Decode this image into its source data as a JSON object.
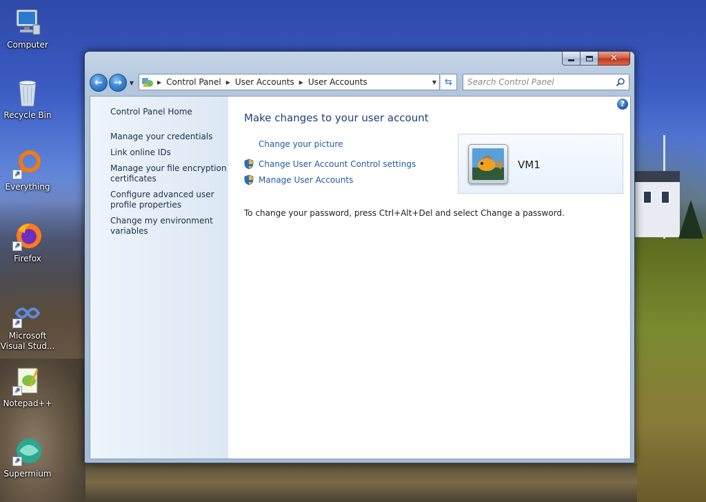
{
  "desktop": {
    "icons": [
      {
        "label": "Computer"
      },
      {
        "label": "Recycle Bin"
      },
      {
        "label": "Everything"
      },
      {
        "label": "Firefox"
      },
      {
        "label": "Microsoft Visual Stud..."
      },
      {
        "label": "Notepad++"
      },
      {
        "label": "Supermium"
      }
    ]
  },
  "window": {
    "controls": {
      "minimize": "minimize",
      "maximize": "maximize",
      "close": "✕"
    },
    "nav": {
      "back": "back",
      "forward": "forward",
      "refresh": "refresh"
    },
    "address": {
      "crumbs": [
        "Control Panel",
        "User Accounts",
        "User Accounts"
      ]
    },
    "search": {
      "placeholder": "Search Control Panel"
    },
    "help": "?",
    "left_pane": {
      "home": "Control Panel Home",
      "links": [
        "Manage your credentials",
        "Link online IDs",
        "Manage your file encryption certificates",
        "Configure advanced user profile properties",
        "Change my environment variables"
      ]
    },
    "main": {
      "title": "Make changes to your user account",
      "tasks": [
        {
          "label": "Change your picture",
          "icon": "none"
        },
        {
          "label": "Change User Account Control settings",
          "icon": "uac-shield-icon"
        },
        {
          "label": "Manage User Accounts",
          "icon": "uac-shield-icon"
        }
      ],
      "password_note": "To change your password, press Ctrl+Alt+Del and select Change a password.",
      "user": {
        "name": "VM1"
      }
    }
  },
  "colors": {
    "link": "#1e5aa8",
    "title": "#1e3f7a",
    "close": "#c3371e"
  }
}
